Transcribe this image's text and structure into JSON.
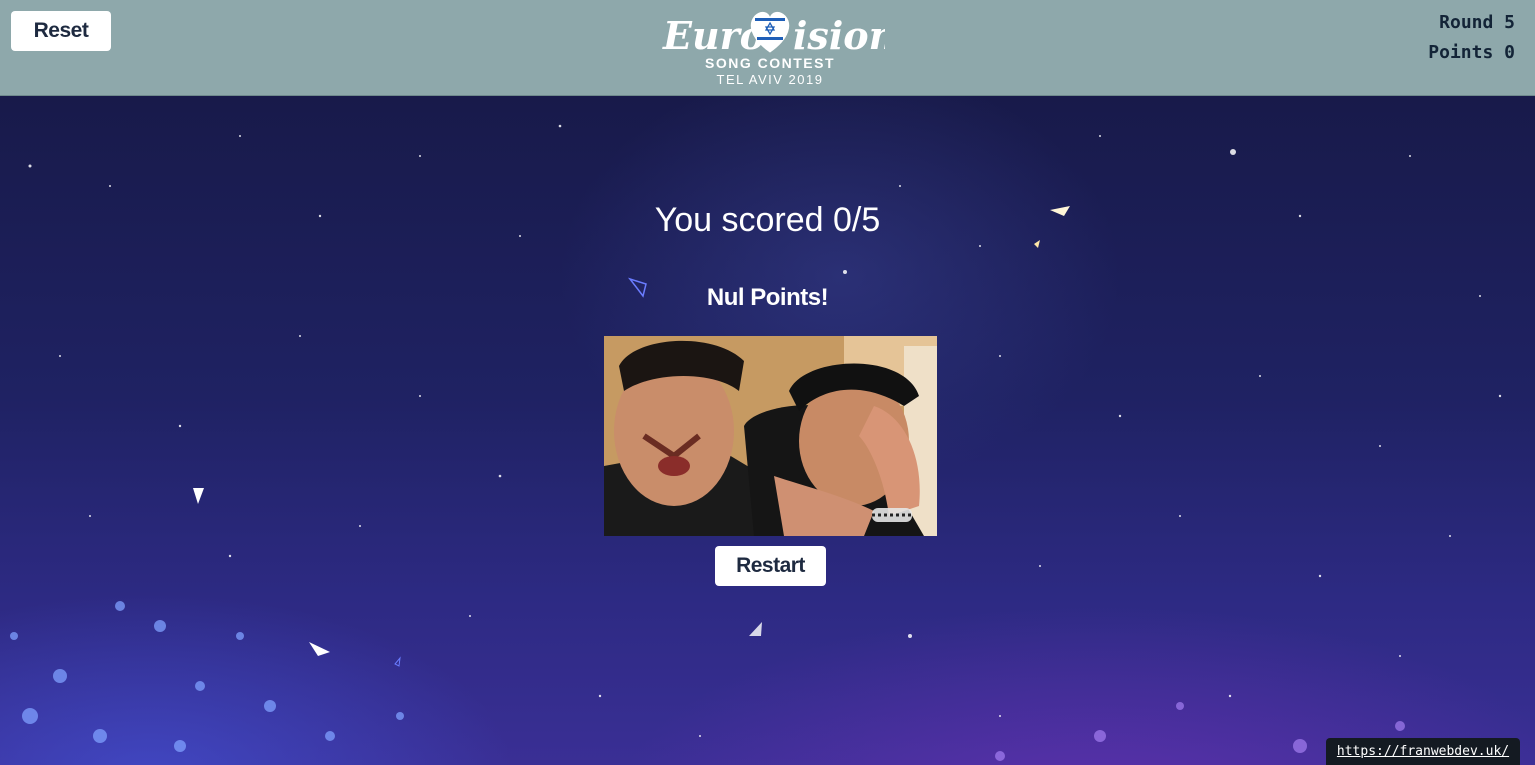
{
  "header": {
    "reset_label": "Reset",
    "logo": {
      "wordmark": "EuroVision",
      "subtitle": "SONG CONTEST",
      "location": "TEL AVIV 2019"
    },
    "round_text": "Round 5",
    "points_text": "Points 0",
    "background_color": "#8ea8ab"
  },
  "result": {
    "score_text": "You scored 0/5",
    "verdict_text": "Nul Points!",
    "image": "crying-contestants-gif",
    "restart_label": "Restart"
  },
  "footer": {
    "link_text": "https://franwebdev.uk/"
  }
}
